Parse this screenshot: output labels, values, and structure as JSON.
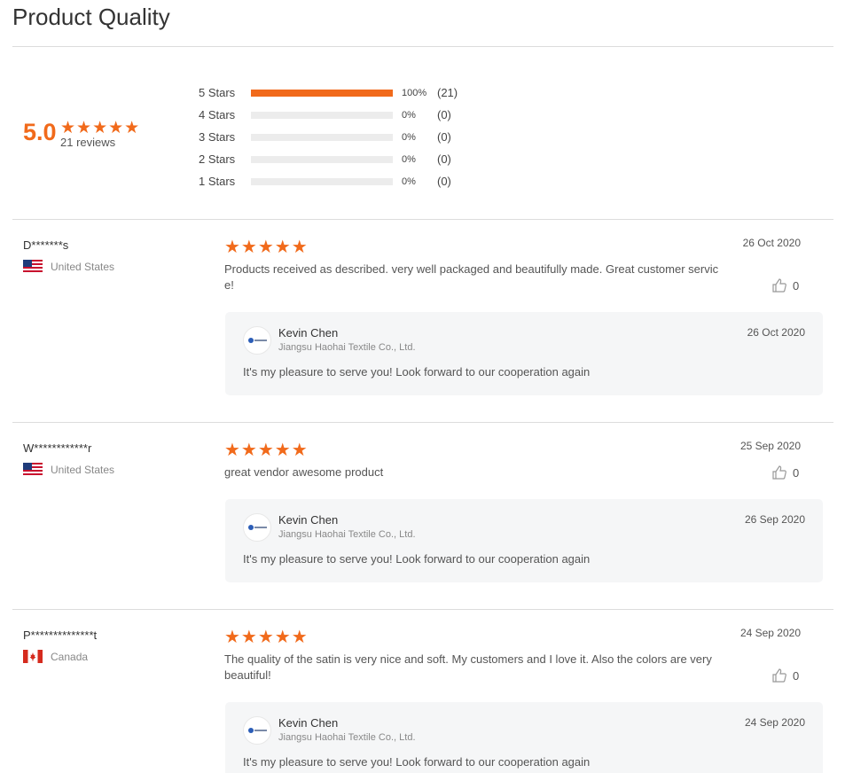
{
  "page": {
    "title": "Product Quality"
  },
  "summary": {
    "score": "5.0",
    "stars": "★★★★★",
    "reviews_label": "21 reviews",
    "accent_color": "#f16a1b",
    "distribution": [
      {
        "label": "5  Stars",
        "fraction": 1.0,
        "percent": "100%",
        "count": "(21)"
      },
      {
        "label": "4  Stars",
        "fraction": 0.0,
        "percent": "0%",
        "count": "(0)"
      },
      {
        "label": "3  Stars",
        "fraction": 0.0,
        "percent": "0%",
        "count": "(0)"
      },
      {
        "label": "2  Stars",
        "fraction": 0.0,
        "percent": "0%",
        "count": "(0)"
      },
      {
        "label": "1  Stars",
        "fraction": 0.0,
        "percent": "0%",
        "count": "(0)"
      }
    ]
  },
  "reviews": [
    {
      "name": "D*******s",
      "country": "United States",
      "flag": "us-flag",
      "stars": "★★★★★",
      "date": "26 Oct 2020",
      "text": "Products received as described. very well packaged and beautifully made. Great customer service!",
      "likes": "0",
      "reply": {
        "name": "Kevin Chen",
        "company": "Jiangsu Haohai Textile Co., Ltd.",
        "date": "26 Oct 2020",
        "text": "It's my pleasure to serve you! Look forward to our cooperation again"
      }
    },
    {
      "name": "W************r",
      "country": "United States",
      "flag": "us-flag",
      "stars": "★★★★★",
      "date": "25 Sep 2020",
      "text": "great vendor awesome product",
      "likes": "0",
      "reply": {
        "name": "Kevin Chen",
        "company": "Jiangsu Haohai Textile Co., Ltd.",
        "date": "26 Sep 2020",
        "text": "It's my pleasure to serve you! Look forward to our cooperation again"
      }
    },
    {
      "name": "P**************t",
      "country": "Canada",
      "flag": "canada-flag",
      "stars": "★★★★★",
      "date": "24 Sep 2020",
      "text": "The quality of the satin is very nice and soft. My customers and I love it. Also the colors are very beautiful!",
      "likes": "0",
      "reply": {
        "name": "Kevin Chen",
        "company": "Jiangsu Haohai Textile Co., Ltd.",
        "date": "24 Sep 2020",
        "text": "It's my pleasure to serve you! Look forward to our cooperation again"
      }
    }
  ]
}
